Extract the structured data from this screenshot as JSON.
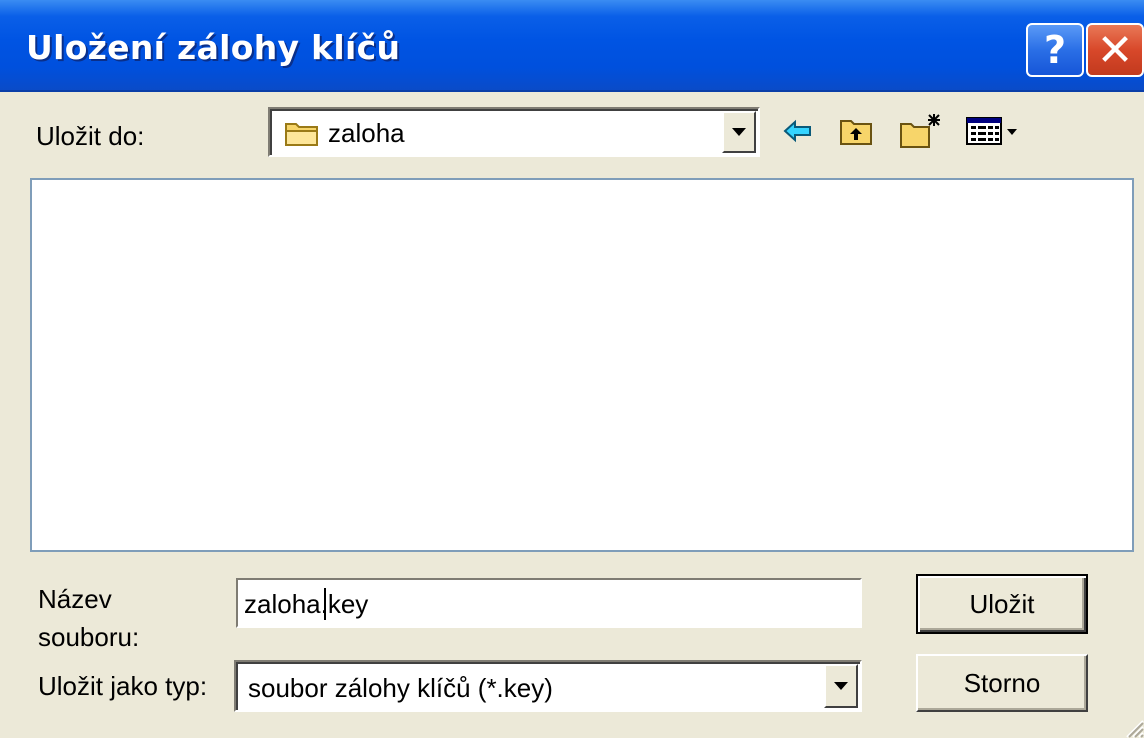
{
  "window": {
    "title": "Uložení zálohy klíčů",
    "help_glyph": "?",
    "close_glyph": "✕"
  },
  "save_in": {
    "label": "Uložit do:",
    "value": "zaloha",
    "folder_icon": "folder-icon"
  },
  "toolbar": {
    "icons": [
      "back-arrow-icon",
      "up-folder-icon",
      "new-folder-icon",
      "view-menu-icon"
    ]
  },
  "file_list": {
    "items": []
  },
  "filename": {
    "label_line1": "Název",
    "label_line2": "souboru:",
    "value_before_caret": "zaloha",
    "value_after_caret": ".key"
  },
  "filetype": {
    "label": "Uložit jako typ:",
    "selected": "soubor zálohy klíčů (*.key)"
  },
  "buttons": {
    "save": "Uložit",
    "cancel": "Storno"
  },
  "colors": {
    "titlebar": "#0054e3",
    "dialog_bg": "#ece9d8",
    "close_red": "#d8482a",
    "list_border": "#7f9db9"
  }
}
